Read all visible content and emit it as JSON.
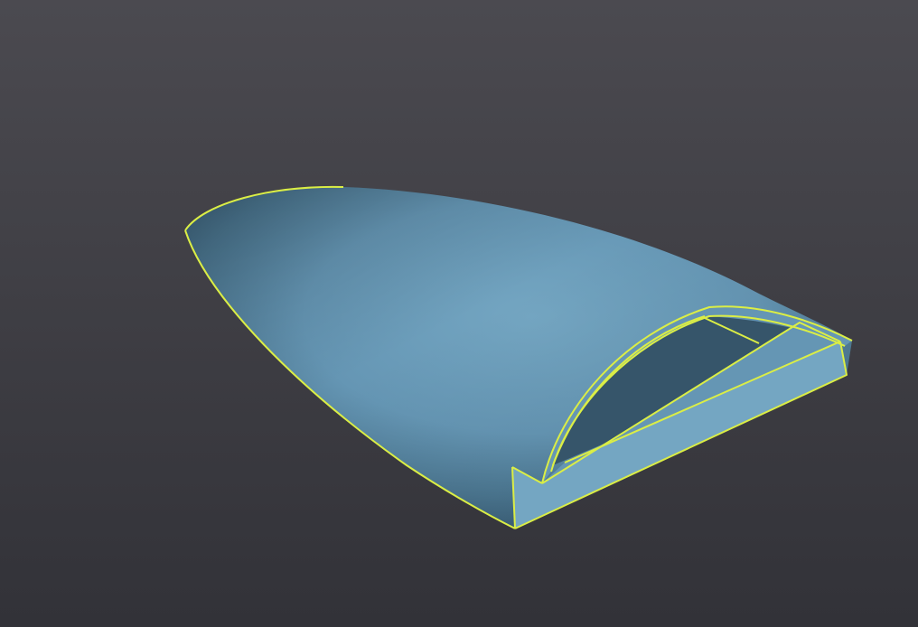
{
  "viewport": {
    "background_top": "#4b4a50",
    "background_bottom": "#323238"
  },
  "model": {
    "body_light": "#74a6c2",
    "body_mid": "#6596b4",
    "body_dark": "#4b7690",
    "body_shadow": "#3c6079",
    "inner_dark": "#36556a",
    "edge_highlight": "#dbee45",
    "selected": true
  }
}
